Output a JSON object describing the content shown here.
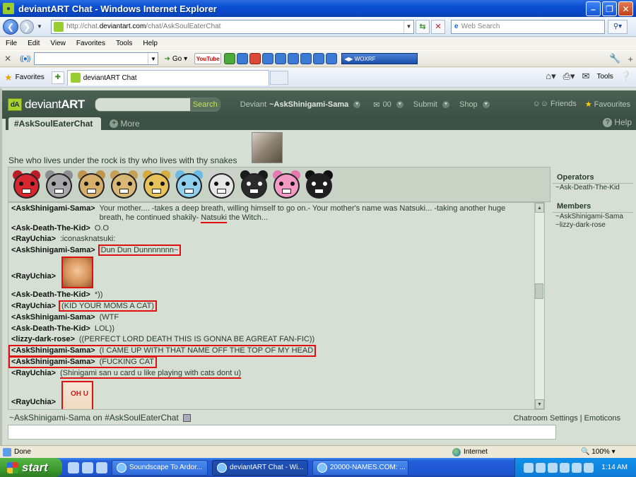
{
  "window": {
    "title": "deviantART Chat - Windows Internet Explorer"
  },
  "address": {
    "url_prefix": "http://chat.",
    "url_host": "deviantart.com",
    "url_path": "/chat/AskSoulEaterChat",
    "search_placeholder": "Web Search"
  },
  "menu": [
    "File",
    "Edit",
    "View",
    "Favorites",
    "Tools",
    "Help"
  ],
  "toolbar": {
    "go_label": "Go",
    "youtube_label": "YouTube",
    "player_text": "WOXRF"
  },
  "favbar": {
    "favorites_label": "Favorites",
    "tab_label": "deviantART Chat",
    "tools_label": "Tools"
  },
  "da": {
    "logo_main": "deviant",
    "logo_bold": "ART",
    "search_button": "Search",
    "user_prefix": "Deviant ",
    "username": "~AskShinigami-Sama",
    "nav_submit": "Submit",
    "nav_shop": "Shop",
    "friends": "Friends",
    "favourites": "Favourites",
    "room_tab": "#AskSoulEaterChat",
    "more_tab": "More",
    "help_tab": "Help",
    "topic": "She who lives under the rock is thy who lives with thy snakes"
  },
  "messages": [
    {
      "nick": "<AskShinigami-Sama>",
      "text_pre": "Your mother.... -takes a deep breath, willing himself to go on.- Your mother's name was Natsuki... -taking another huge breath, he continued shakily- ",
      "text_ul": "Natsuki",
      "text_post": " the Witch..."
    },
    {
      "nick": "<Ask-Death-The-Kid>",
      "text": "O.O"
    },
    {
      "nick": "<RayUchia>",
      "text": ":iconasknatsuki:"
    },
    {
      "nick": "<AskShinigami-Sama>",
      "text": "Dun Dun Dunnnnnnn~"
    },
    {
      "nick": "<RayUchia>",
      "image": "cat"
    },
    {
      "nick": "<Ask-Death-The-Kid>",
      "text": "*))"
    },
    {
      "nick": "<RayUchia>",
      "text": "(KID YOUR MOMS A CAT)"
    },
    {
      "nick": "<AskShinigami-Sama>",
      "text": "(WTF"
    },
    {
      "nick": "<Ask-Death-The-Kid>",
      "text": "LOL))"
    },
    {
      "nick": "<lizzy-dark-rose>",
      "text": "((PERFECT LORD DEATH THIS IS GONNA BE AGREAT FAN-FIC))"
    },
    {
      "nick": "<AskShinigami-Sama>",
      "text": "(I CAME UP WITH THAT NAME OFF THE TOP OF MY HEAD"
    },
    {
      "nick": "<AskShinigami-Sama>",
      "text": "(FUCKING CAT"
    },
    {
      "nick": "<RayUchia>",
      "text": "(Shinigami san u card u like playing with cats dont u)"
    },
    {
      "nick": "<RayUchia>",
      "image": "ohu",
      "image_text": "OH U"
    }
  ],
  "sidebar": {
    "operators_title": "Operators",
    "operators": [
      "~Ask-Death-The-Kid"
    ],
    "members_title": "Members",
    "members": [
      "~AskShinigami-Sama",
      "~lizzy-dark-rose"
    ]
  },
  "footer": {
    "status": "~AskShinigami-Sama on #AskSoulEaterChat",
    "settings": "Chatroom Settings",
    "separator": "|",
    "emoticons": "Emoticons"
  },
  "ie_status": {
    "done": "Done",
    "zone": "Internet",
    "zoom": "100%"
  },
  "taskbar": {
    "start": "start",
    "tasks": [
      "Soundscape To Ardor...",
      "deviantART Chat - Wi...",
      "20000-NAMES.COM: ..."
    ],
    "clock": "1:14 AM"
  },
  "bears": [
    {
      "fur": "#d8262e",
      "ear": "#b81e25"
    },
    {
      "fur": "#a8a8ac",
      "ear": "#8e8e92"
    },
    {
      "fur": "#d6b06a",
      "ear": "#c09550"
    },
    {
      "fur": "#d9b774",
      "ear": "#c79f58"
    },
    {
      "fur": "#e7c25b",
      "ear": "#d6ab3f"
    },
    {
      "fur": "#8fd0ef",
      "ear": "#6cb9e2"
    },
    {
      "fur": "#e6e6e6",
      "ear": "#cfcfcf"
    },
    {
      "fur": "#2b2b2b",
      "ear": "#1a1a1a"
    },
    {
      "fur": "#f29ac4",
      "ear": "#e47aaf"
    },
    {
      "fur": "#1e1e1e",
      "ear": "#101010"
    }
  ]
}
